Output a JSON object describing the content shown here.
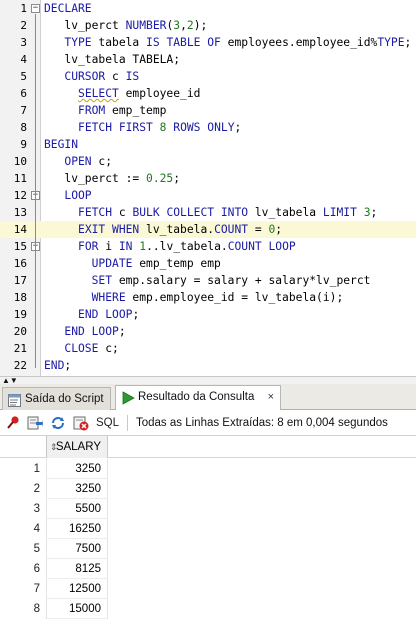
{
  "editor": {
    "lines": [
      {
        "n": "1",
        "html": "<span class=\"kw\">DECLARE</span>"
      },
      {
        "n": "2",
        "html": "   lv_perct <span class=\"kw\">NUMBER</span>(<span class=\"num\">3</span>,<span class=\"num\">2</span>);"
      },
      {
        "n": "3",
        "html": "   <span class=\"kw\">TYPE</span> tabela <span class=\"kw\">IS TABLE OF</span> employees.employee_id%<span class=\"kw\">TYPE</span>;"
      },
      {
        "n": "4",
        "html": "   lv_tabela TABELA;"
      },
      {
        "n": "5",
        "html": "   <span class=\"kw\">CURSOR</span> c <span class=\"kw\">IS</span>"
      },
      {
        "n": "6",
        "html": "     <span class=\"kw squiggle\">SELECT</span> employee_id"
      },
      {
        "n": "7",
        "html": "     <span class=\"kw\">FROM</span> emp_temp"
      },
      {
        "n": "8",
        "html": "     <span class=\"kw\">FETCH FIRST</span> <span class=\"num\">8</span> <span class=\"kw\">ROWS ONLY</span>;"
      },
      {
        "n": "9",
        "html": "<span class=\"kw\">BEGIN</span>"
      },
      {
        "n": "10",
        "html": "   <span class=\"kw\">OPEN</span> c;"
      },
      {
        "n": "11",
        "html": "   lv_perct := <span class=\"num\">0.25</span>;"
      },
      {
        "n": "12",
        "html": "   <span class=\"kw\">LOOP</span>"
      },
      {
        "n": "13",
        "html": "     <span class=\"kw\">FETCH</span> c <span class=\"kw\">BULK COLLECT INTO</span> lv_tabela <span class=\"kw\">LIMIT</span> <span class=\"num\">3</span>;"
      },
      {
        "n": "14",
        "html": "     <span class=\"kw\">EXIT WHEN</span> lv_tabela.<span class=\"kw\">COUNT</span> = <span class=\"num\">0</span>;"
      },
      {
        "n": "15",
        "html": "     <span class=\"kw\">FOR</span> i <span class=\"kw\">IN</span> <span class=\"num\">1</span>..lv_tabela.<span class=\"kw\">COUNT LOOP</span>"
      },
      {
        "n": "16",
        "html": "       <span class=\"kw\">UPDATE</span> emp_temp emp"
      },
      {
        "n": "17",
        "html": "       <span class=\"kw\">SET</span> emp.salary = salary + salary*lv_perct"
      },
      {
        "n": "18",
        "html": "       <span class=\"kw\">WHERE</span> emp.employee_id = lv_tabela(i);"
      },
      {
        "n": "19",
        "html": "     <span class=\"kw\">END LOOP</span>;"
      },
      {
        "n": "20",
        "html": "   <span class=\"kw\">END LOOP</span>;"
      },
      {
        "n": "21",
        "html": "   <span class=\"kw\">CLOSE</span> c;"
      },
      {
        "n": "22",
        "html": "<span class=\"kw\">END</span>;"
      }
    ]
  },
  "tabs": {
    "script_output": "Saída do Script",
    "query_result": "Resultado da Consulta",
    "close": "×"
  },
  "toolbar": {
    "sql_label": "SQL",
    "separator": "|",
    "status": "Todas as Linhas Extraídas: 8 em 0,004 segundos"
  },
  "grid": {
    "column": "SALARY",
    "rows": [
      {
        "n": "1",
        "salary": "3250"
      },
      {
        "n": "2",
        "salary": "3250"
      },
      {
        "n": "3",
        "salary": "5500"
      },
      {
        "n": "4",
        "salary": "16250"
      },
      {
        "n": "5",
        "salary": "7500"
      },
      {
        "n": "6",
        "salary": "8125"
      },
      {
        "n": "7",
        "salary": "12500"
      },
      {
        "n": "8",
        "salary": "15000"
      }
    ]
  },
  "colors": {
    "keyword": "#1a1aa6",
    "number": "#1f7a1f",
    "current_line": "#fbf8d6"
  },
  "icons": [
    "collapse-icon",
    "expand-icon",
    "script-output-icon",
    "run-icon",
    "pin-icon",
    "export-icon",
    "refresh-icon",
    "cancel-icon",
    "sort-icon",
    "splitter-arrows-icon"
  ]
}
